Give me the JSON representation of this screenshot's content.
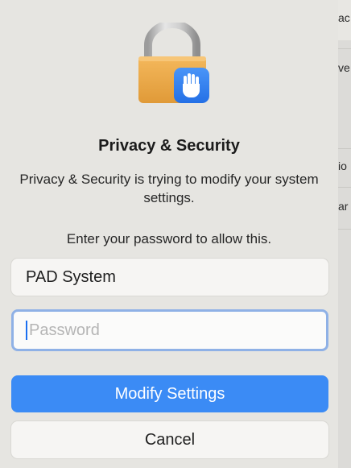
{
  "dialog": {
    "title": "Privacy & Security",
    "message": "Privacy & Security is trying to modify your system settings.",
    "prompt": "Enter your password to allow this.",
    "icon": "lock-hand-icon"
  },
  "fields": {
    "username_value": "PAD System",
    "password_placeholder": "Password",
    "password_value": ""
  },
  "buttons": {
    "primary_label": "Modify Settings",
    "cancel_label": "Cancel"
  },
  "background_window": {
    "row_fragments": [
      "ac",
      "ve",
      "io",
      "ar"
    ]
  },
  "colors": {
    "accent": "#3b8bf5",
    "lock_body": "#f0a84a",
    "badge": "#2f7ef0"
  }
}
